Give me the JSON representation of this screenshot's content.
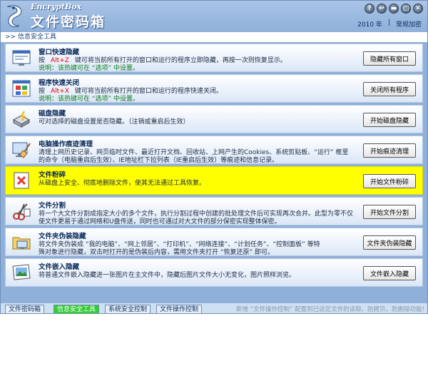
{
  "app": {
    "brand_en": "EncryptBox",
    "brand_cn": "文件密码箱",
    "version": "2010 年",
    "settings_link": "常规加密",
    "window_buttons": [
      "?",
      "↩",
      "▬",
      "□",
      "✕"
    ]
  },
  "breadcrumb": ">> 信息安全工具",
  "features": [
    {
      "title": "窗口快速隐藏",
      "line1_pre": "按",
      "hotkey": "Alt+Z",
      "line1_post": "键可将当前所有打开的窗口和运行的程序立即隐藏，再按一次则恢复显示。",
      "line2": "说明：该热键可在 “选项” 中设置。",
      "button": "隐藏所有窗口",
      "icon": "window-hide-icon"
    },
    {
      "title": "程序快速关闭",
      "line1_pre": "按",
      "hotkey": "Alt+X",
      "line1_post": "键可将当前所有打开的窗口和运行的程序快速关闭。",
      "line2": "说明：该热键可在 “选项” 中设置。",
      "button": "关闭所有程序",
      "icon": "program-close-icon"
    },
    {
      "title": "磁盘隐藏",
      "line1": "可对选择的磁盘设置是否隐藏。（注销或重启后生效）",
      "button": "开始磁盘隐藏",
      "icon": "disk-hide-icon"
    },
    {
      "title": "电脑操作痕迹清理",
      "line1": "清理上网历史记录、网页临时文件、最近打开文档、回收站、上网产生的Cookies、系统剪贴板、“运行” 框里",
      "line2": "的命令（电脑重启后生效）、IE地址栏下拉列表（IE重启后生效）等痕迹和信息记录。",
      "button": "开始痕迹清理",
      "icon": "trace-clean-icon"
    },
    {
      "title": "文件粉碎",
      "line1": "从磁盘上安全、彻底地删除文件，使其无法通过工具恢复。",
      "button": "开始文件粉碎",
      "icon": "file-shred-icon",
      "highlight": true
    },
    {
      "title": "文件分割",
      "line1": "将一个大文件分割成指定大小的多个文件，执行分割过程中创建的批处理文件后可实现再次合并。此型为零不仅",
      "line2": "使文件更易于通过网络和U盘传送，同时也可通过对大文件的部分保密实现整体保密。",
      "button": "开始文件分割",
      "icon": "file-split-icon"
    },
    {
      "title": "文件夹伪装隐藏",
      "line1": "将文件夹伪装成 “我的电脑”、“网上邻居”、“打印机”、“网络连接”、“计划任务”、“控制面板” 等特",
      "line2": "殊对象进行隐藏，双击时打开的是伪装后内容，需用文件夹打开 “恢复还原” 即可。",
      "button": "文件夹伪装隐藏",
      "icon": "folder-disguise-icon"
    },
    {
      "title": "文件嵌入隐藏",
      "line1": "将普通文件嵌入隐藏进一张图片在主文件中，隐藏后图片文件大小无变化，图片照样浏览。",
      "button": "文件嵌入隐藏",
      "icon": "file-embed-icon"
    }
  ],
  "tabs": [
    "文件密码箱",
    "信息安全工具",
    "系统安全控制",
    "文件操作控制"
  ],
  "active_tab": 1,
  "marquee": "新增 “文件操作控制” 配置到已设定文件的读取、防拷贝、防删除功能!",
  "colors": {
    "frame": "#8fb0d9",
    "highlight": "#ffff00",
    "hotkey": "#e00000",
    "note": "#0b7a1a",
    "active_tab": "#33cc33"
  }
}
